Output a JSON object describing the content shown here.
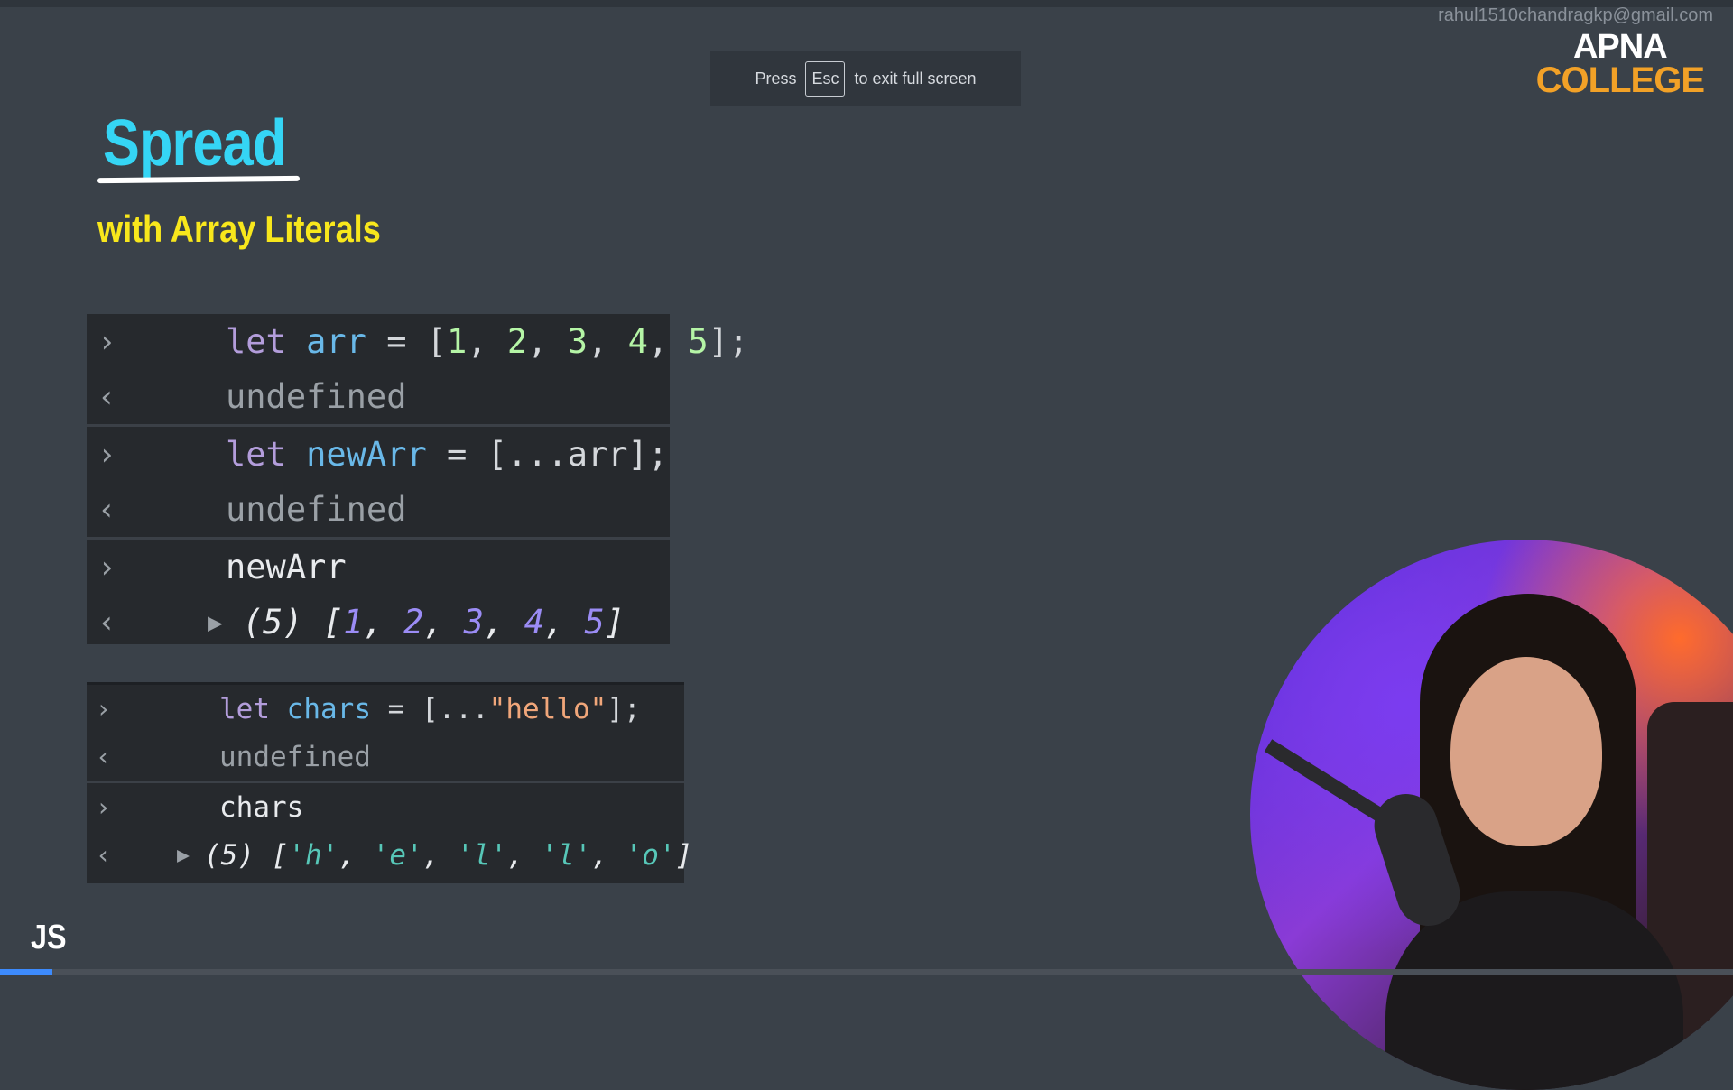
{
  "overlay": {
    "email": "rahul1510chandragkp@gmail.com",
    "logo_line1": "APNA",
    "logo_line2": "COLLEGE",
    "esc_before": "Press",
    "esc_key": "Esc",
    "esc_after": "to exit full screen"
  },
  "slide": {
    "title": "Spread",
    "subtitle": "with Array Literals",
    "badge": "JS"
  },
  "console1": {
    "l1": {
      "kw": "let",
      "var": "arr",
      "eq": " = [",
      "n1": "1",
      "c1": ", ",
      "n2": "2",
      "c2": ", ",
      "n3": "3",
      "c3": ", ",
      "n4": "4",
      "c4": ", ",
      "n5": "5",
      "end": "];"
    },
    "r1": "undefined",
    "l2": {
      "kw": "let",
      "var": "newArr",
      "rest": " = [...arr];"
    },
    "r2": "undefined",
    "l3": "newArr",
    "r3": {
      "count": "(5) ",
      "open": "[",
      "v1": "1",
      "v2": "2",
      "v3": "3",
      "v4": "4",
      "v5": "5",
      "sep": ", ",
      "close": "]"
    }
  },
  "console2": {
    "l1": {
      "kw": "let",
      "var": "chars",
      "mid": " = [...",
      "str": "\"hello\"",
      "end": "];"
    },
    "r1": "undefined",
    "l2": "chars",
    "r2": {
      "count": "(5) ",
      "open": "[",
      "v1": "'h'",
      "v2": "'e'",
      "v3": "'l'",
      "v4": "'l'",
      "v5": "'o'",
      "sep": ", ",
      "close": "]"
    }
  },
  "video": {
    "progress": 0.03
  },
  "colors": {
    "title": "#35d5f5",
    "subtitle": "#f8e71c",
    "logo_accent": "#f2a127",
    "background": "#3a4149"
  }
}
